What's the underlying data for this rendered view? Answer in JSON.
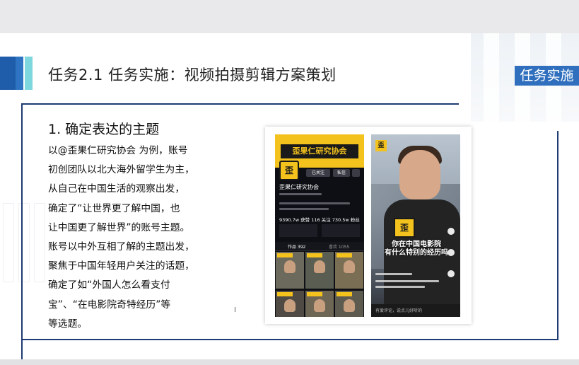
{
  "slide": {
    "title": "任务2.1  任务实施：视频拍摄剪辑方案策划",
    "tag": "任务实施",
    "heading": "1. 确定表达的主题",
    "paragraph_lines": [
      "以@歪果仁研究协会 为例，账号",
      "初创团队以北大海外留学生为主，",
      "从自己在中国生活的观察出发，",
      "确定了“让世界更了解中国，也",
      "让中国更了解世界”的账号主题。",
      "账号以中外互相了解的主题出发，",
      "聚焦于中国年轻用户关注的话题，",
      "确定了如“外国人怎么看支付",
      "宝”、“在电影院奇特经历”等",
      "等选题。"
    ],
    "cursor_glyph": "I"
  },
  "profile_screen": {
    "banner": "歪果仁研究协会",
    "avatar_char": "歪",
    "followed_button": "已关注",
    "message_button": "私信",
    "account_name": "歪果仁研究协会",
    "stats": "9390.7w 获赞  116 关注  730.5w 粉丝",
    "tab_works": "作品 392",
    "tab_likes": "喜欢 1055"
  },
  "video_screen": {
    "badge_char": "歪",
    "mic_char": "歪",
    "caption_lines": [
      "你在中国电影院",
      "有什么特别的经历吗"
    ],
    "comment_placeholder": "有爱评论，说点儿好听的"
  }
}
